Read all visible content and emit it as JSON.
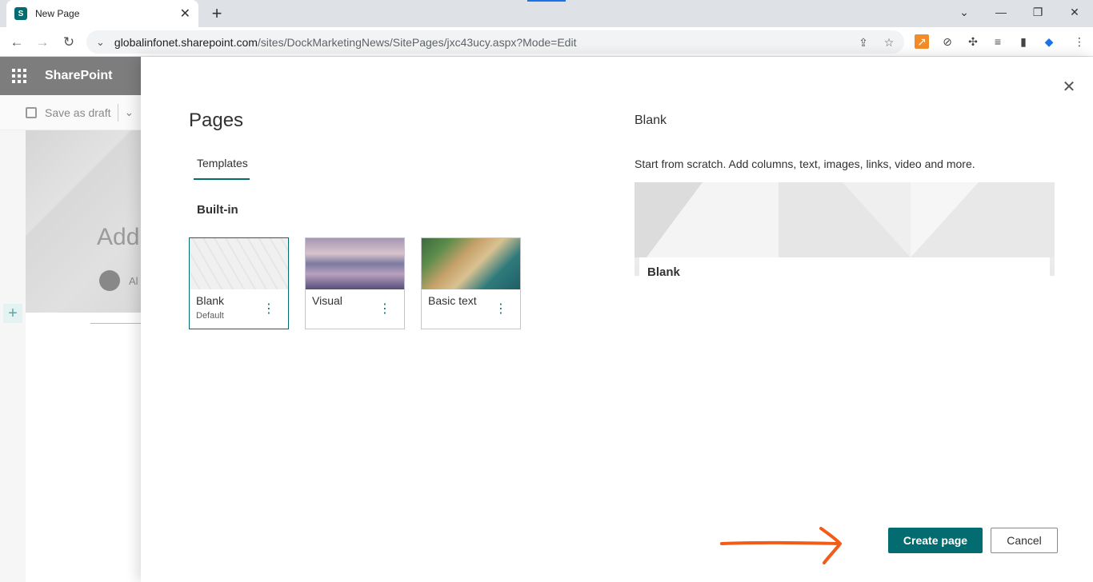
{
  "browser": {
    "tab_title": "New Page",
    "url_host": "globalinfonet.sharepoint.com",
    "url_path": "/sites/DockMarketingNews/SitePages/jxc43ucy.aspx?Mode=Edit",
    "favicon_letter": "S"
  },
  "sharepoint": {
    "brand": "SharePoint",
    "save_draft_label": "Save as draft",
    "hero_title_fragment": "Add",
    "author_fragment": "Al"
  },
  "panel": {
    "title": "Pages",
    "tab_label": "Templates",
    "section_label": "Built-in",
    "templates": [
      {
        "label": "Blank",
        "sublabel": "Default"
      },
      {
        "label": "Visual",
        "sublabel": ""
      },
      {
        "label": "Basic text",
        "sublabel": ""
      }
    ],
    "preview": {
      "title": "Blank",
      "description": "Start from scratch. Add columns, text, images, links, video and more.",
      "card_label": "Blank"
    },
    "create_label": "Create page",
    "cancel_label": "Cancel"
  },
  "colors": {
    "accent": "#036c70",
    "arrow": "#f25c19"
  }
}
